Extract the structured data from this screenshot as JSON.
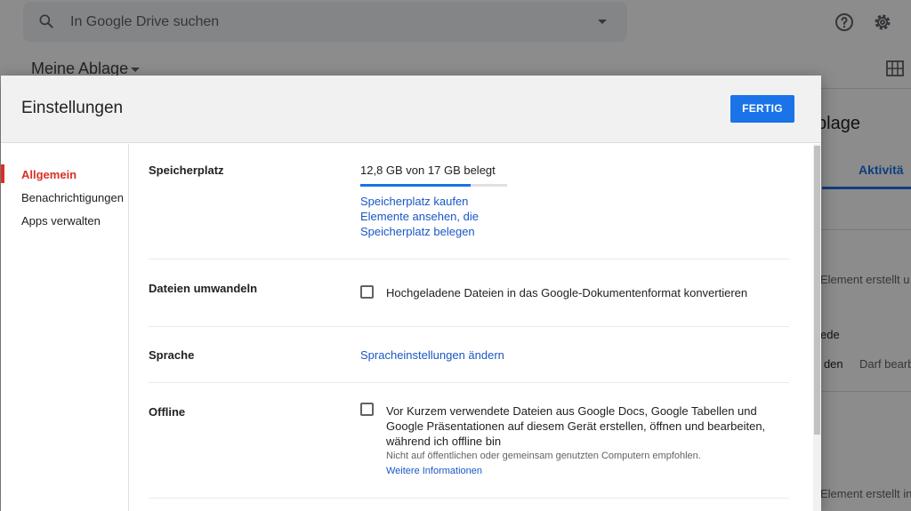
{
  "app": {
    "search_placeholder": "In Google Drive suchen",
    "breadcrumb": "Meine Ablage",
    "bg_title_fragment": "blage",
    "bg_tab": "Aktivitä",
    "bg_lines": [
      "Element erstellt u",
      "ede",
      "r den",
      "Darf bearbe",
      "Element erstellt in"
    ]
  },
  "dialog": {
    "title": "Einstellungen",
    "done_label": "FERTIG",
    "nav": [
      {
        "label": "Allgemein",
        "active": true
      },
      {
        "label": "Benachrichtigungen",
        "active": false
      },
      {
        "label": "Apps verwalten",
        "active": false
      }
    ],
    "storage": {
      "label": "Speicherplatz",
      "usage": "12,8 GB von 17 GB belegt",
      "used_fraction": 0.753,
      "buy_link": "Speicherplatz kaufen",
      "view_link_line1": "Elemente ansehen, die",
      "view_link_line2": "Speicherplatz belegen"
    },
    "convert": {
      "label": "Dateien umwandeln",
      "checkbox_text": "Hochgeladene Dateien in das Google-Dokumentenformat konvertieren",
      "checked": false
    },
    "language": {
      "label": "Sprache",
      "link": "Spracheinstellungen ändern"
    },
    "offline": {
      "label": "Offline",
      "checkbox_text": "Vor Kurzem verwendete Dateien aus Google Docs, Google Tabellen und Google Präsentationen auf diesem Gerät erstellen, öffnen und bearbeiten, während ich offline bin",
      "note": "Nicht auf öffentlichen oder gemeinsam genutzten Computern empfohlen.",
      "more_link": "Weitere Informationen",
      "checked": false
    }
  },
  "colors": {
    "accent": "#1a73e8",
    "active_nav": "#d93025",
    "link": "#1a57c6"
  }
}
